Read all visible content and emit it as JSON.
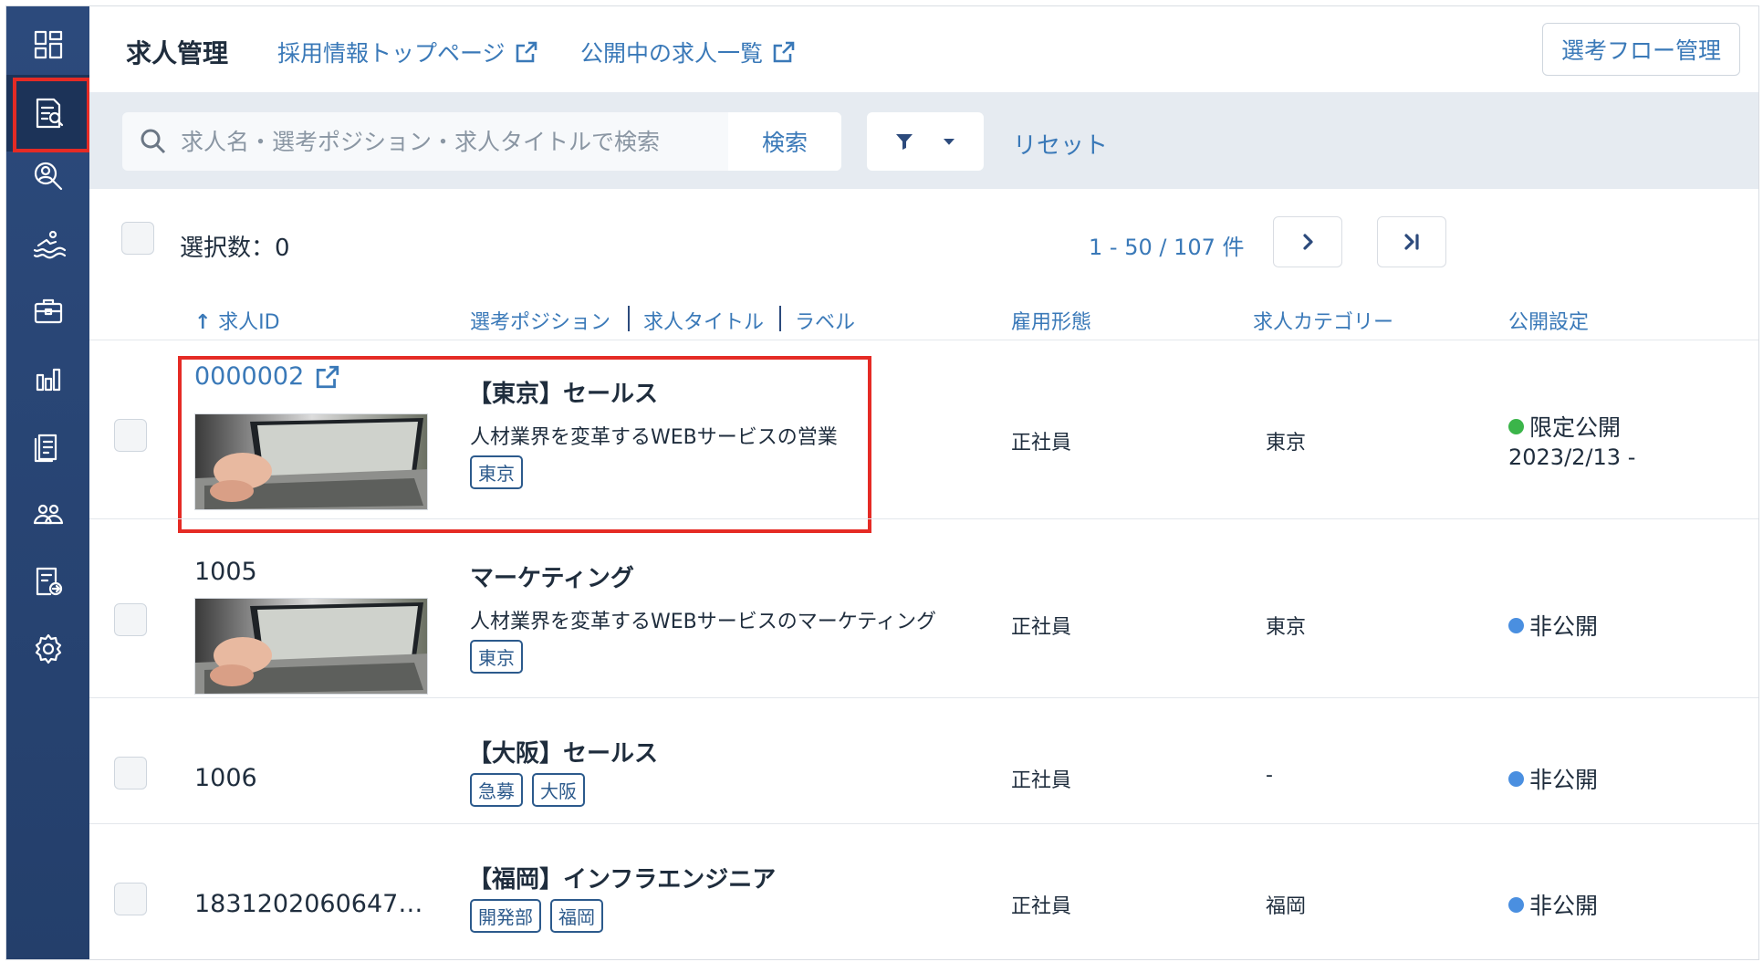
{
  "header": {
    "title": "求人管理",
    "links": [
      {
        "label": "採用情報トップページ"
      },
      {
        "label": "公開中の求人一覧"
      }
    ],
    "flow_button": "選考フロー管理"
  },
  "sidebar": {
    "items": [
      {
        "icon": "dashboard-icon"
      },
      {
        "icon": "job-list-icon",
        "active": true
      },
      {
        "icon": "candidate-search-icon"
      },
      {
        "icon": "swimmer-icon"
      },
      {
        "icon": "briefcase-icon"
      },
      {
        "icon": "bar-chart-icon"
      },
      {
        "icon": "documents-icon"
      },
      {
        "icon": "users-icon"
      },
      {
        "icon": "document-export-icon"
      },
      {
        "icon": "gear-icon"
      }
    ]
  },
  "search": {
    "placeholder": "求人名・選考ポジション・求人タイトルで検索",
    "value": "",
    "button": "検索",
    "reset": "リセット"
  },
  "toolbar": {
    "selected_label": "選択数：0",
    "pager": "1 - 50 / 107 件"
  },
  "columns": {
    "id": "求人ID",
    "position": "選考ポジション",
    "title": "求人タイトル",
    "label": "ラベル",
    "employment": "雇用形態",
    "category": "求人カテゴリー",
    "publish": "公開設定"
  },
  "colors": {
    "accent": "#3a79b8",
    "sidebar": "#2c4a7c",
    "highlight": "#e52b25",
    "status_limited": "#3bb54a",
    "status_private": "#4a8fe0"
  },
  "rows": [
    {
      "id": "0000002",
      "position": "【東京】セールス",
      "subtitle": "人材業界を変革するWEBサービスの営業",
      "tags": [
        "東京"
      ],
      "employment": "正社員",
      "category": "東京",
      "status": "限定公開",
      "status_color": "#3bb54a",
      "date": "2023/2/13 -"
    },
    {
      "id": "1005",
      "position": "マーケティング",
      "subtitle": "人材業界を変革するWEBサービスのマーケティング",
      "tags": [
        "東京"
      ],
      "employment": "正社員",
      "category": "東京",
      "status": "非公開",
      "status_color": "#4a8fe0"
    },
    {
      "id": "1006",
      "position": "【大阪】セールス",
      "tags": [
        "急募",
        "大阪"
      ],
      "employment": "正社員",
      "category": "-",
      "status": "非公開",
      "status_color": "#4a8fe0"
    },
    {
      "id": "1831202060647…",
      "position": "【福岡】インフラエンジニア",
      "tags": [
        "開発部",
        "福岡"
      ],
      "employment": "正社員",
      "category": "福岡",
      "status": "非公開",
      "status_color": "#4a8fe0"
    }
  ]
}
